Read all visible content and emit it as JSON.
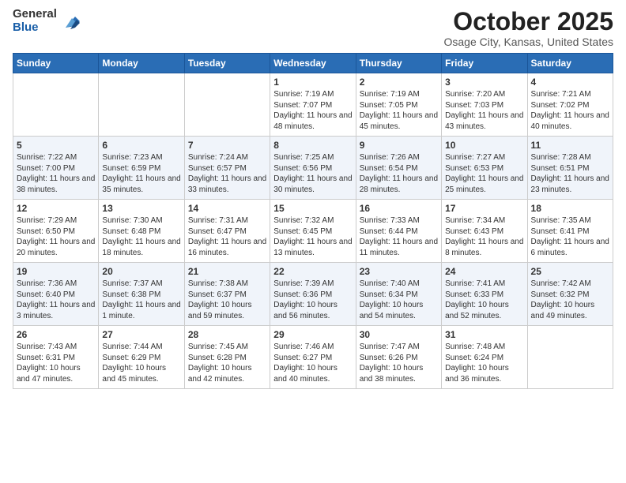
{
  "logo": {
    "general": "General",
    "blue": "Blue"
  },
  "title": "October 2025",
  "location": "Osage City, Kansas, United States",
  "days_of_week": [
    "Sunday",
    "Monday",
    "Tuesday",
    "Wednesday",
    "Thursday",
    "Friday",
    "Saturday"
  ],
  "weeks": [
    [
      {
        "day": "",
        "info": ""
      },
      {
        "day": "",
        "info": ""
      },
      {
        "day": "",
        "info": ""
      },
      {
        "day": "1",
        "info": "Sunrise: 7:19 AM\nSunset: 7:07 PM\nDaylight: 11 hours and 48 minutes."
      },
      {
        "day": "2",
        "info": "Sunrise: 7:19 AM\nSunset: 7:05 PM\nDaylight: 11 hours and 45 minutes."
      },
      {
        "day": "3",
        "info": "Sunrise: 7:20 AM\nSunset: 7:03 PM\nDaylight: 11 hours and 43 minutes."
      },
      {
        "day": "4",
        "info": "Sunrise: 7:21 AM\nSunset: 7:02 PM\nDaylight: 11 hours and 40 minutes."
      }
    ],
    [
      {
        "day": "5",
        "info": "Sunrise: 7:22 AM\nSunset: 7:00 PM\nDaylight: 11 hours and 38 minutes."
      },
      {
        "day": "6",
        "info": "Sunrise: 7:23 AM\nSunset: 6:59 PM\nDaylight: 11 hours and 35 minutes."
      },
      {
        "day": "7",
        "info": "Sunrise: 7:24 AM\nSunset: 6:57 PM\nDaylight: 11 hours and 33 minutes."
      },
      {
        "day": "8",
        "info": "Sunrise: 7:25 AM\nSunset: 6:56 PM\nDaylight: 11 hours and 30 minutes."
      },
      {
        "day": "9",
        "info": "Sunrise: 7:26 AM\nSunset: 6:54 PM\nDaylight: 11 hours and 28 minutes."
      },
      {
        "day": "10",
        "info": "Sunrise: 7:27 AM\nSunset: 6:53 PM\nDaylight: 11 hours and 25 minutes."
      },
      {
        "day": "11",
        "info": "Sunrise: 7:28 AM\nSunset: 6:51 PM\nDaylight: 11 hours and 23 minutes."
      }
    ],
    [
      {
        "day": "12",
        "info": "Sunrise: 7:29 AM\nSunset: 6:50 PM\nDaylight: 11 hours and 20 minutes."
      },
      {
        "day": "13",
        "info": "Sunrise: 7:30 AM\nSunset: 6:48 PM\nDaylight: 11 hours and 18 minutes."
      },
      {
        "day": "14",
        "info": "Sunrise: 7:31 AM\nSunset: 6:47 PM\nDaylight: 11 hours and 16 minutes."
      },
      {
        "day": "15",
        "info": "Sunrise: 7:32 AM\nSunset: 6:45 PM\nDaylight: 11 hours and 13 minutes."
      },
      {
        "day": "16",
        "info": "Sunrise: 7:33 AM\nSunset: 6:44 PM\nDaylight: 11 hours and 11 minutes."
      },
      {
        "day": "17",
        "info": "Sunrise: 7:34 AM\nSunset: 6:43 PM\nDaylight: 11 hours and 8 minutes."
      },
      {
        "day": "18",
        "info": "Sunrise: 7:35 AM\nSunset: 6:41 PM\nDaylight: 11 hours and 6 minutes."
      }
    ],
    [
      {
        "day": "19",
        "info": "Sunrise: 7:36 AM\nSunset: 6:40 PM\nDaylight: 11 hours and 3 minutes."
      },
      {
        "day": "20",
        "info": "Sunrise: 7:37 AM\nSunset: 6:38 PM\nDaylight: 11 hours and 1 minute."
      },
      {
        "day": "21",
        "info": "Sunrise: 7:38 AM\nSunset: 6:37 PM\nDaylight: 10 hours and 59 minutes."
      },
      {
        "day": "22",
        "info": "Sunrise: 7:39 AM\nSunset: 6:36 PM\nDaylight: 10 hours and 56 minutes."
      },
      {
        "day": "23",
        "info": "Sunrise: 7:40 AM\nSunset: 6:34 PM\nDaylight: 10 hours and 54 minutes."
      },
      {
        "day": "24",
        "info": "Sunrise: 7:41 AM\nSunset: 6:33 PM\nDaylight: 10 hours and 52 minutes."
      },
      {
        "day": "25",
        "info": "Sunrise: 7:42 AM\nSunset: 6:32 PM\nDaylight: 10 hours and 49 minutes."
      }
    ],
    [
      {
        "day": "26",
        "info": "Sunrise: 7:43 AM\nSunset: 6:31 PM\nDaylight: 10 hours and 47 minutes."
      },
      {
        "day": "27",
        "info": "Sunrise: 7:44 AM\nSunset: 6:29 PM\nDaylight: 10 hours and 45 minutes."
      },
      {
        "day": "28",
        "info": "Sunrise: 7:45 AM\nSunset: 6:28 PM\nDaylight: 10 hours and 42 minutes."
      },
      {
        "day": "29",
        "info": "Sunrise: 7:46 AM\nSunset: 6:27 PM\nDaylight: 10 hours and 40 minutes."
      },
      {
        "day": "30",
        "info": "Sunrise: 7:47 AM\nSunset: 6:26 PM\nDaylight: 10 hours and 38 minutes."
      },
      {
        "day": "31",
        "info": "Sunrise: 7:48 AM\nSunset: 6:24 PM\nDaylight: 10 hours and 36 minutes."
      },
      {
        "day": "",
        "info": ""
      }
    ]
  ]
}
